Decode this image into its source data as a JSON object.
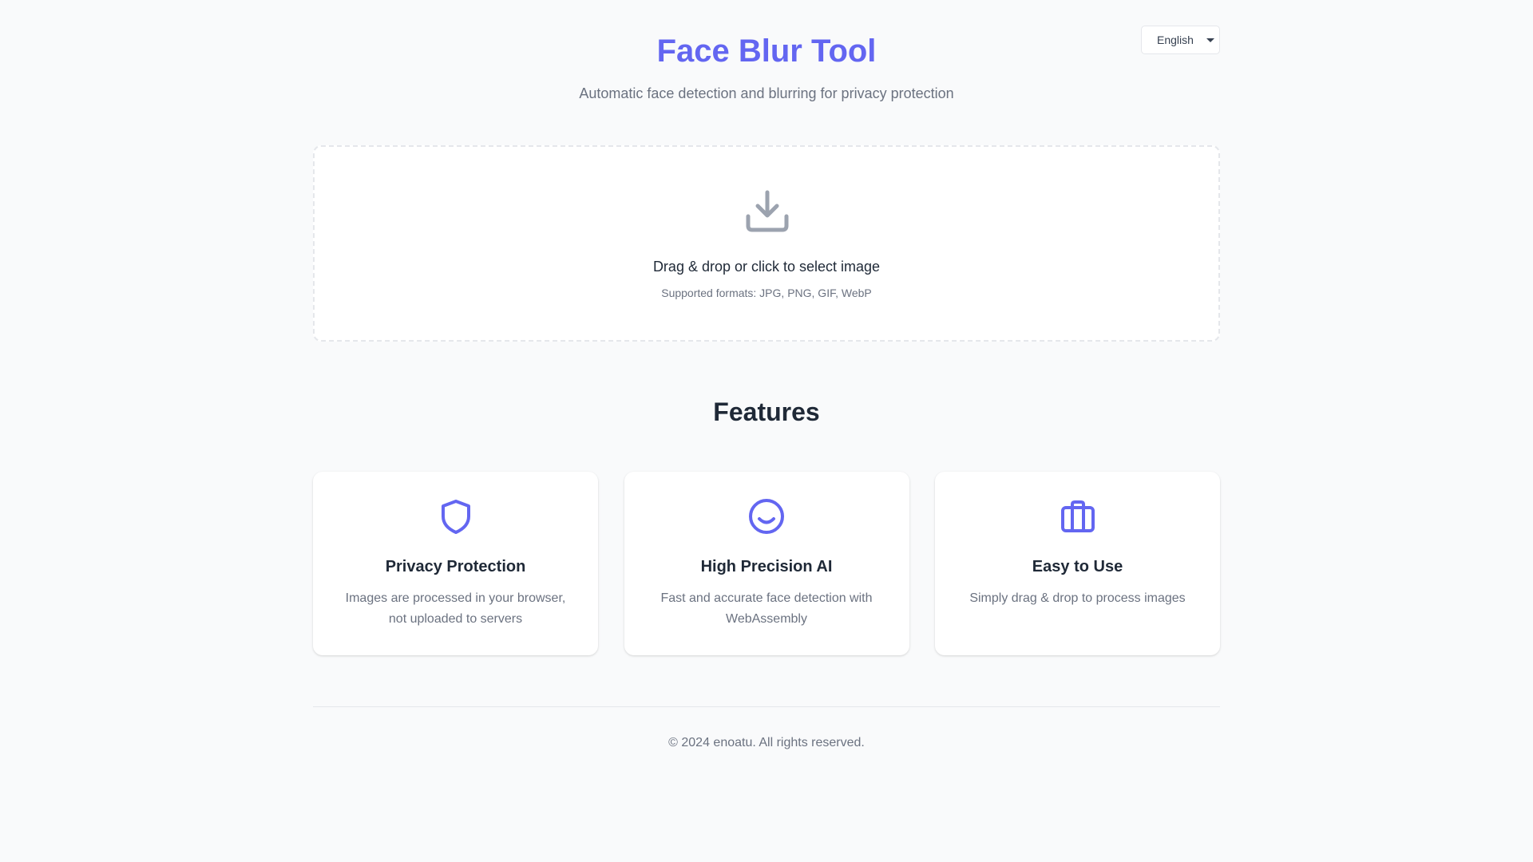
{
  "header": {
    "title": "Face Blur Tool",
    "subtitle": "Automatic face detection and blurring for privacy protection"
  },
  "language": {
    "selected": "English",
    "icon": "chevron-down-icon"
  },
  "upload": {
    "icon": "download-tray-icon",
    "prompt": "Drag & drop or click to select image",
    "formats": "Supported formats: JPG, PNG, GIF, WebP"
  },
  "features": {
    "heading": "Features",
    "items": [
      {
        "icon": "shield-icon",
        "title": "Privacy Protection",
        "description": "Images are processed in your browser, not uploaded to servers"
      },
      {
        "icon": "smiley-face-icon",
        "title": "High Precision AI",
        "description": "Fast and accurate face detection with WebAssembly"
      },
      {
        "icon": "briefcase-icon",
        "title": "Easy to Use",
        "description": "Simply drag & drop to process images"
      }
    ]
  },
  "footer": {
    "copyright": "© 2024 enoatu. All rights reserved."
  },
  "colors": {
    "accent": "#6366f1",
    "background": "#f9fafb",
    "text_primary": "#1f2937",
    "text_muted": "#6b7280",
    "icon_muted": "#9ca3af",
    "border": "#e5e7eb"
  }
}
